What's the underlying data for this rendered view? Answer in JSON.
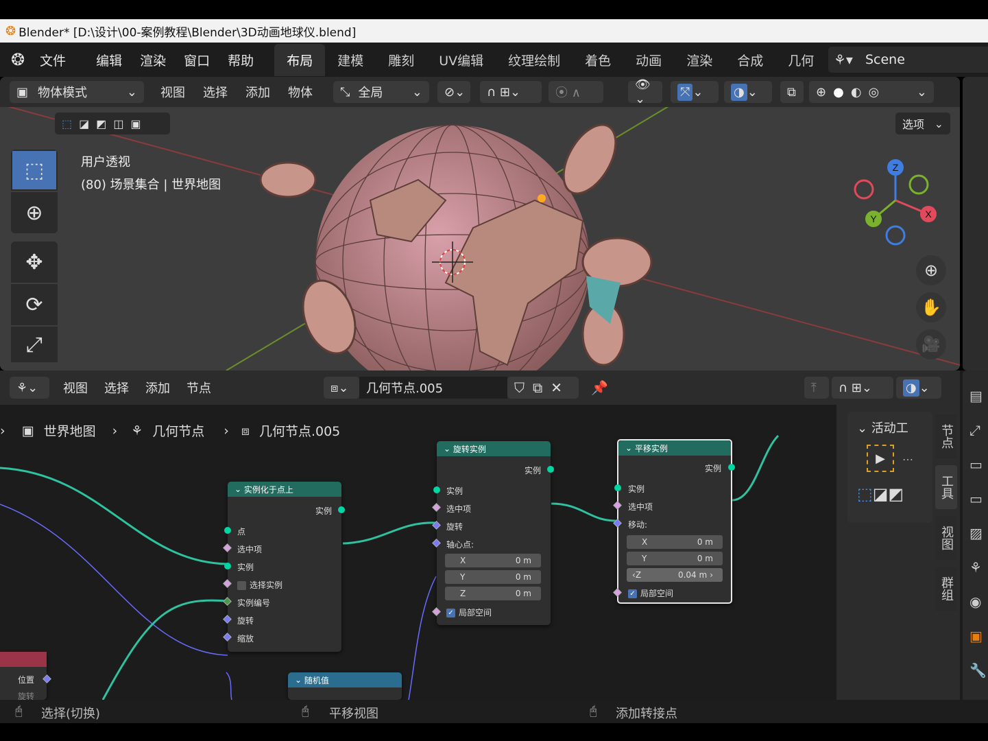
{
  "window": {
    "title": "Blender* [D:\\设计\\00-案例教程\\Blender\\3D动画地球仪.blend]"
  },
  "menu": {
    "items": [
      "文件",
      "编辑",
      "渲染",
      "窗口",
      "帮助"
    ]
  },
  "workspaces": [
    "布局",
    "建模",
    "雕刻",
    "UV编辑",
    "纹理绘制",
    "着色",
    "动画",
    "渲染",
    "合成",
    "几何"
  ],
  "scene": {
    "name": "Scene"
  },
  "viewport": {
    "mode": "物体模式",
    "menus": [
      "视图",
      "选择",
      "添加",
      "物体"
    ],
    "transform_orientation": "全局",
    "options_label": "选项",
    "overlay_title": "用户透视",
    "overlay_collection": "(80) 场景集合 | 世界地图",
    "gizmo_axes": {
      "x": "X",
      "y": "Y",
      "z": "Z"
    }
  },
  "node_editor": {
    "menus": [
      "视图",
      "选择",
      "添加",
      "节点"
    ],
    "node_group": "几何节点.005",
    "breadcrumb": [
      "世界地图",
      "几何节点",
      "几何节点.005"
    ],
    "sidebar_title": "活动工",
    "tabs": [
      "节点",
      "工具",
      "视图",
      "群组"
    ]
  },
  "nodes": {
    "instance_on_points": {
      "title": "实例化于点上",
      "output": "实例",
      "inputs": [
        "点",
        "选中项",
        "实例",
        "选择实例",
        "实例编号",
        "旋转",
        "缩放"
      ]
    },
    "rotate_instances": {
      "title": "旋转实例",
      "output": "实例",
      "inputs": [
        "实例",
        "选中项",
        "旋转",
        "轴心点:"
      ],
      "fields": [
        {
          "axis": "X",
          "value": "0 m"
        },
        {
          "axis": "Y",
          "value": "0 m"
        },
        {
          "axis": "Z",
          "value": "0 m"
        }
      ],
      "local_space": "局部空间"
    },
    "translate_instances": {
      "title": "平移实例",
      "output": "实例",
      "inputs": [
        "实例",
        "选中项",
        "移动:"
      ],
      "fields": [
        {
          "axis": "X",
          "value": "0 m"
        },
        {
          "axis": "Y",
          "value": "0 m"
        },
        {
          "axis": "Z",
          "value": "0.04 m"
        }
      ],
      "local_space": "局部空间"
    },
    "random_value": {
      "title": "随机值"
    },
    "position_node": {
      "output": "位置",
      "output2": "旋转"
    }
  },
  "status": {
    "select": "选择(切换)",
    "pan": "平移视图",
    "add_reroute": "添加转接点"
  }
}
